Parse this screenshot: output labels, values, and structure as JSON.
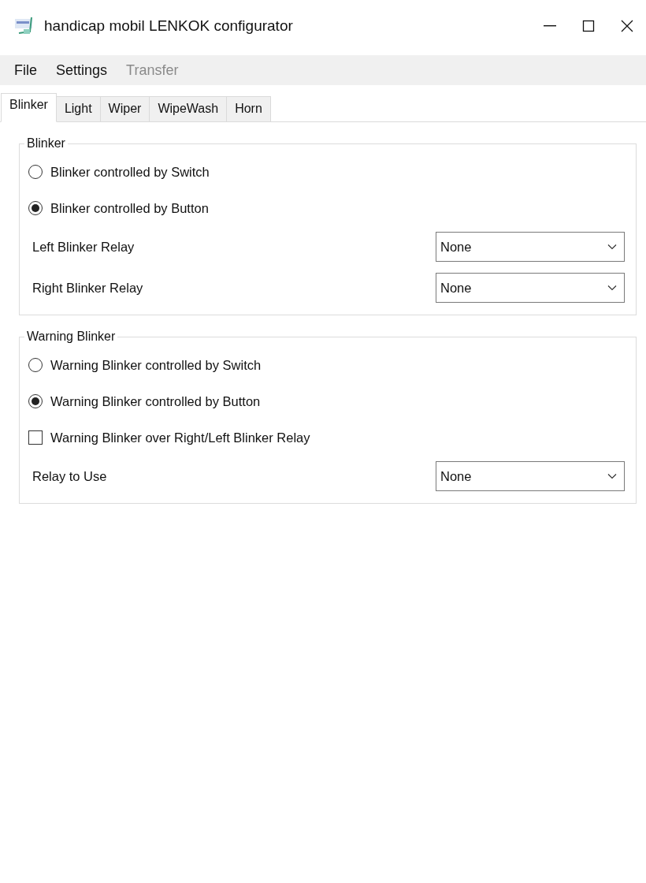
{
  "window": {
    "title": "handicap mobil LENKOK configurator"
  },
  "menu": [
    {
      "label": "File",
      "disabled": false
    },
    {
      "label": "Settings",
      "disabled": false
    },
    {
      "label": "Transfer",
      "disabled": true
    }
  ],
  "tabs": [
    {
      "label": "Blinker",
      "selected": true
    },
    {
      "label": "Light",
      "selected": false
    },
    {
      "label": "Wiper",
      "selected": false
    },
    {
      "label": "WipeWash",
      "selected": false
    },
    {
      "label": "Horn",
      "selected": false
    }
  ],
  "groups": [
    {
      "title": "Blinker",
      "items": [
        {
          "kind": "radio",
          "label": "Blinker controlled by Switch",
          "selected": false
        },
        {
          "kind": "radio",
          "label": "Blinker controlled by Button",
          "selected": true
        },
        {
          "kind": "dropdown",
          "label": "Left Blinker Relay",
          "value": "None"
        },
        {
          "kind": "dropdown",
          "label": "Right Blinker Relay",
          "value": "None"
        }
      ]
    },
    {
      "title": "Warning Blinker",
      "items": [
        {
          "kind": "radio",
          "label": "Warning Blinker controlled by Switch",
          "selected": false
        },
        {
          "kind": "radio",
          "label": "Warning Blinker controlled by Button",
          "selected": true
        },
        {
          "kind": "checkbox",
          "label": "Warning Blinker over Right/Left Blinker Relay",
          "checked": false
        },
        {
          "kind": "dropdown",
          "label": "Relay to Use",
          "value": "None"
        }
      ]
    }
  ]
}
